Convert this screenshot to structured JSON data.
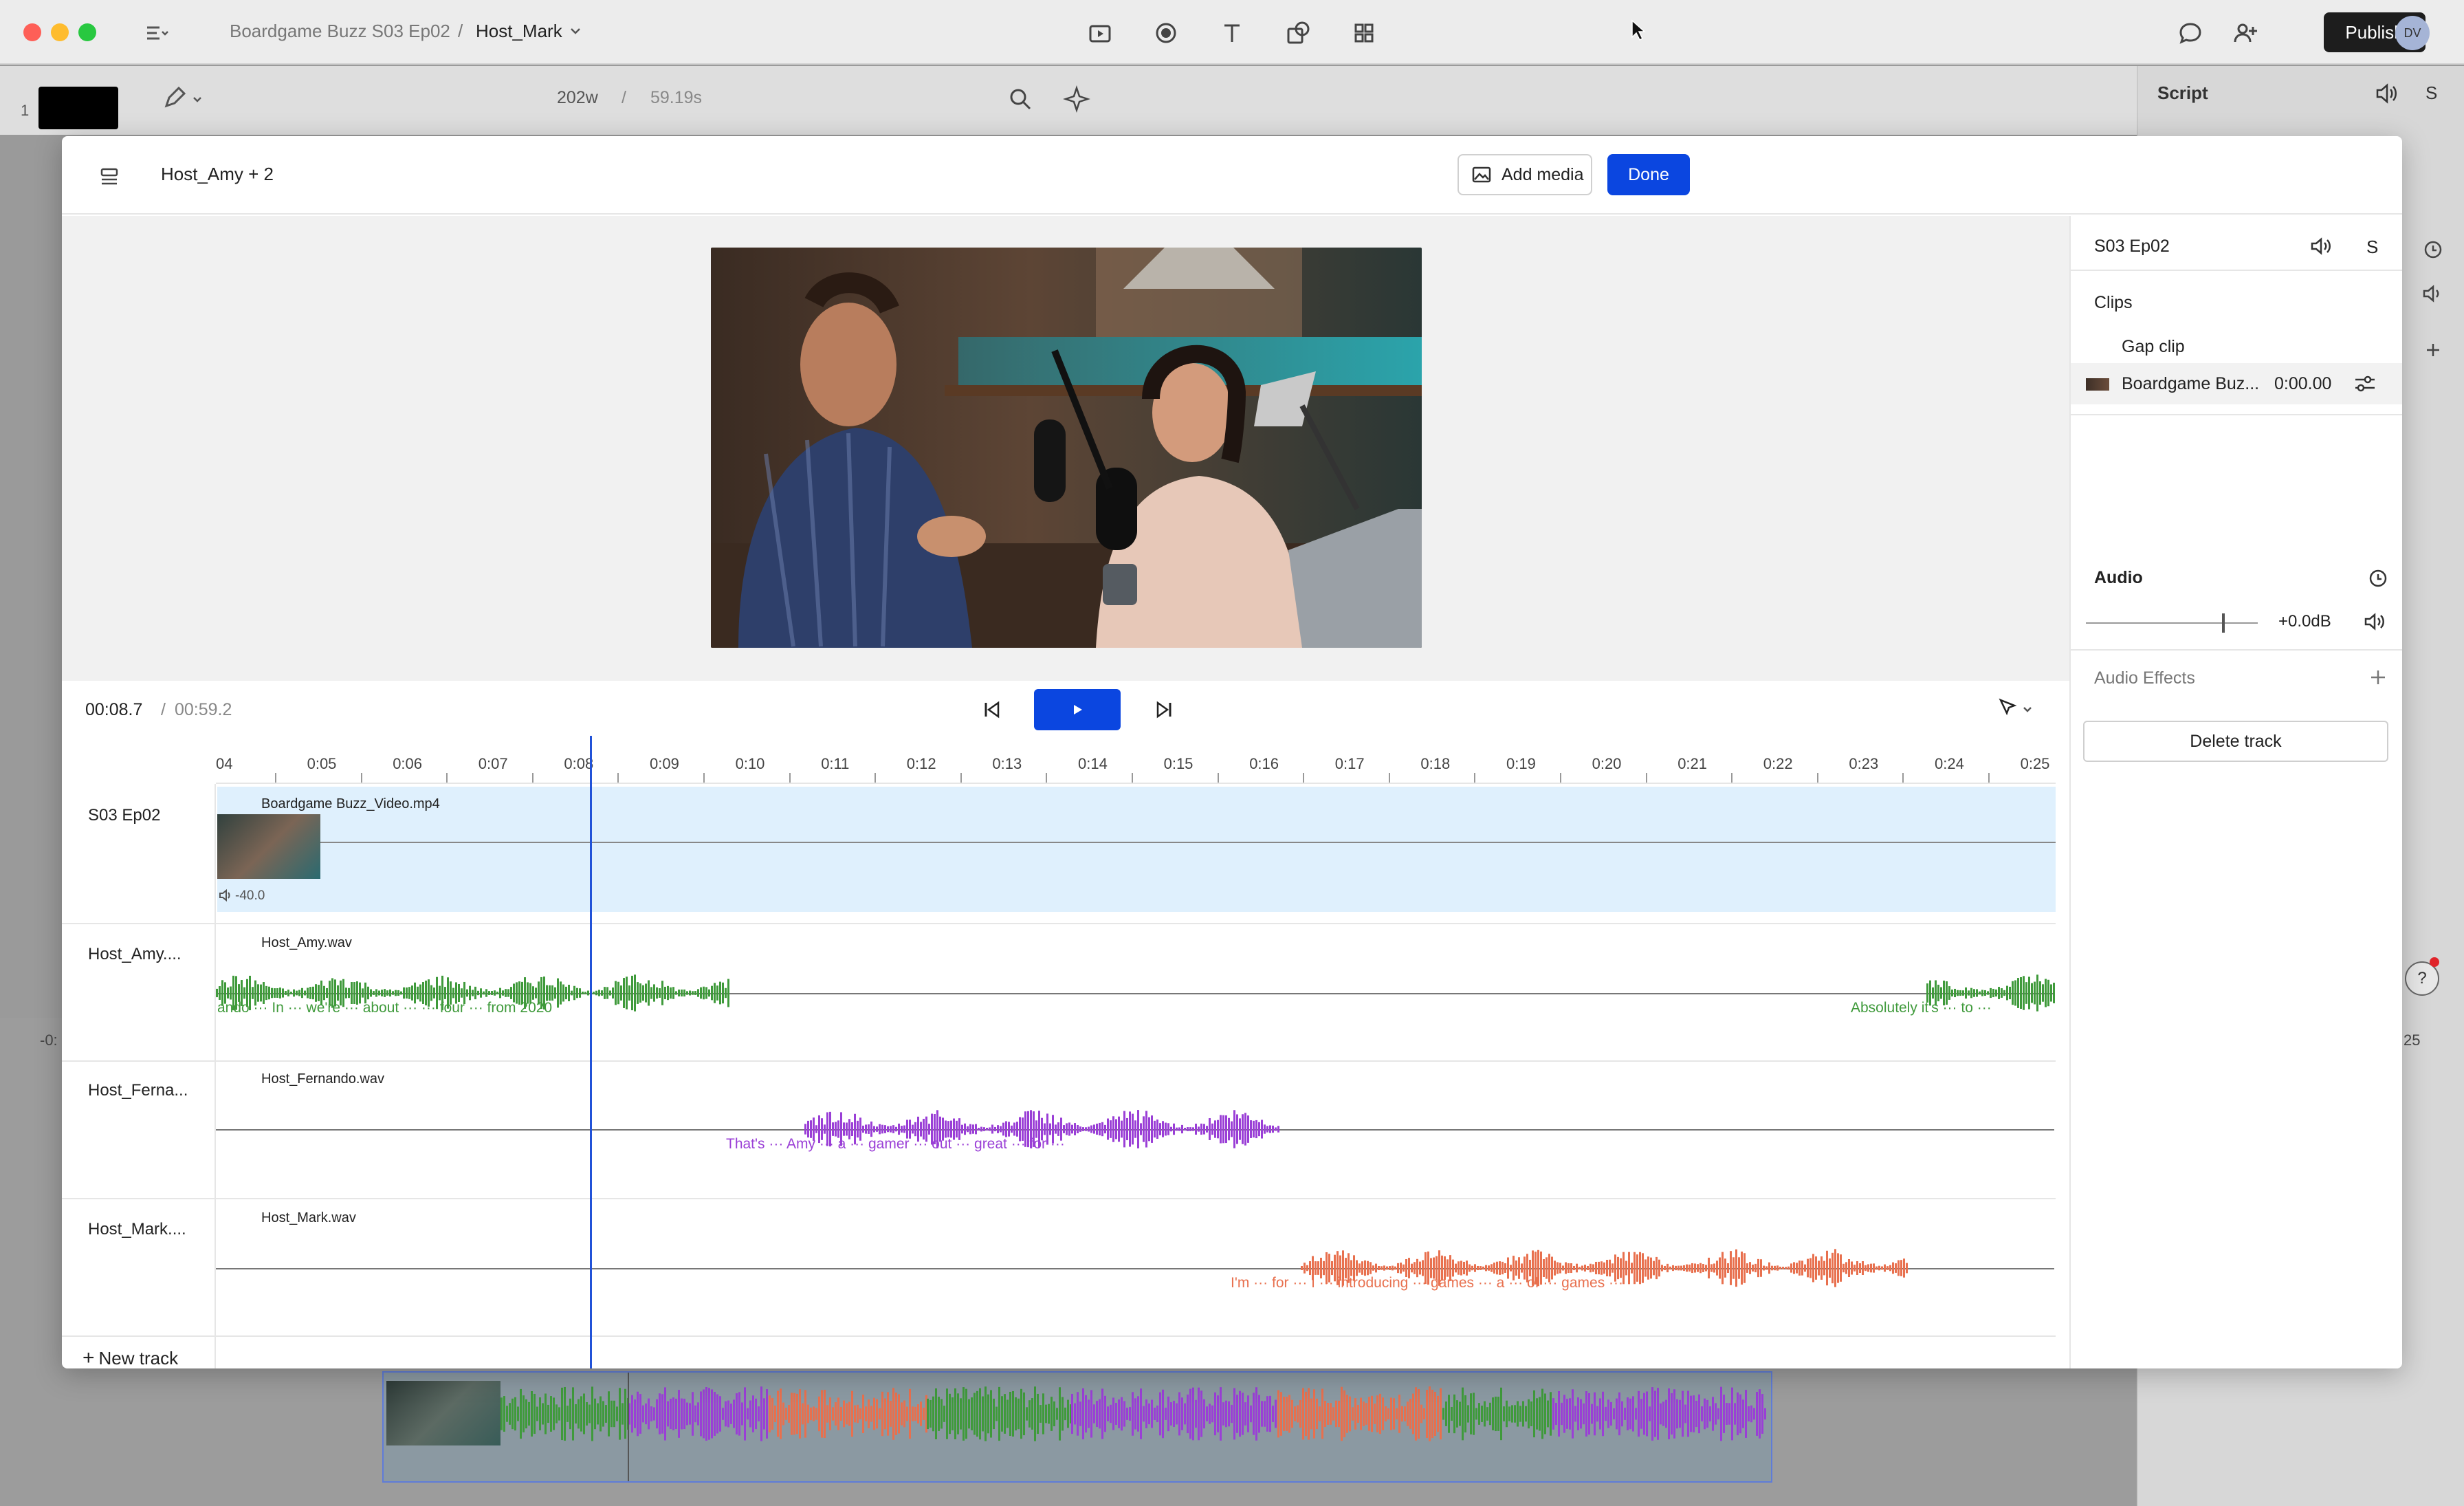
{
  "app": {
    "breadcrumb_project": "Boardgame Buzz S03 Ep02",
    "breadcrumb_separator": "/",
    "breadcrumb_composition": "Host_Mark",
    "publish_label": "Publish",
    "user_initials": "DV",
    "script_panel_title": "Script",
    "script_panel_letter": "S",
    "word_count": "202w",
    "duration_divider": "/",
    "duration": "59.19s",
    "page_number": "1",
    "bg_left_marker": "-0:",
    "bg_right_marker": "25",
    "help_label": "?"
  },
  "modal": {
    "title": "Host_Amy + 2",
    "add_media_label": "Add media",
    "done_label": "Done"
  },
  "transport": {
    "current_time": "00:08.7",
    "separator": "/",
    "total_time": "00:59.2"
  },
  "ruler": {
    "ticks": [
      "04",
      "0:05",
      "0:06",
      "0:07",
      "0:08",
      "0:09",
      "0:10",
      "0:11",
      "0:12",
      "0:13",
      "0:14",
      "0:15",
      "0:16",
      "0:17",
      "0:18",
      "0:19",
      "0:20",
      "0:21",
      "0:22",
      "0:23",
      "0:24",
      "0:25"
    ]
  },
  "tracks": [
    {
      "name": "S03 Ep02",
      "clip": "Boardgame Buzz_Video.mp4",
      "volume_label": "-40.0",
      "color": "#dff0fd"
    },
    {
      "name": "Host_Amy....",
      "clip": "Host_Amy.wav",
      "color": "#3f9a3b",
      "words_a": "ando  ···   In   ···   we're   ···   about   ···   ···   four   ···   from 2020",
      "words_b": "Absolutely   it's ···   to   ···"
    },
    {
      "name": "Host_Ferna...",
      "clip": "Host_Fernando.wav",
      "color": "#9a3fd6",
      "words_a": "That's ···   Amy   ···   a ···  gamer   ···   out   ···   great ···   for ···"
    },
    {
      "name": "Host_Mark....",
      "clip": "Host_Mark.wav",
      "color": "#e8704e",
      "words_a": "I'm ···   for   ···   I ···   introducing   ···   games   ···   a   ···   of ···   games   ···"
    }
  ],
  "new_track_label": "New track",
  "inspector": {
    "title": "S03 Ep02",
    "letter": "S",
    "clips_heading": "Clips",
    "gap_clip": "Gap clip",
    "clip_name": "Boardgame Buz...",
    "clip_time": "0:00.00",
    "audio_heading": "Audio",
    "gain": "+0.0dB",
    "gain_level": 0.85,
    "audio_effects": "Audio Effects",
    "delete_track": "Delete track"
  }
}
